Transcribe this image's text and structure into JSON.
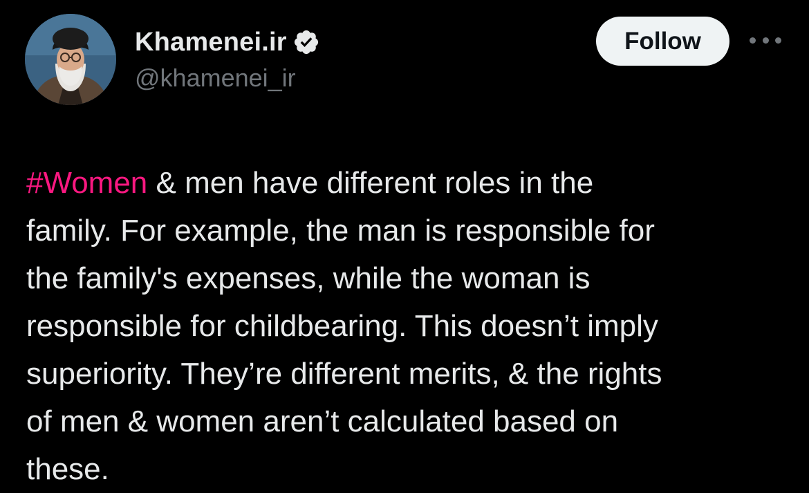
{
  "author": {
    "display_name": "Khamenei.ir",
    "handle": "@khamenei_ir",
    "verified": true,
    "avatar_icon": "profile-photo"
  },
  "actions": {
    "follow_label": "Follow",
    "more_icon": "more-horizontal-icon"
  },
  "tweet": {
    "hashtag": "#Women",
    "line1_rest": " & men have different roles in the",
    "lines": [
      "family. For example, the man is responsible for",
      "the family's expenses, while the woman is",
      "responsible for childbearing. This doesn’t imply",
      "superiority. They’re different merits, & the rights",
      "of men & women aren’t calculated based on",
      "these."
    ]
  },
  "colors": {
    "background": "#000000",
    "text": "#e7e9ea",
    "secondary_text": "#71767b",
    "hashtag": "#f91880",
    "verified_badge": "#e7e9ea",
    "follow_bg": "#eff3f4"
  }
}
